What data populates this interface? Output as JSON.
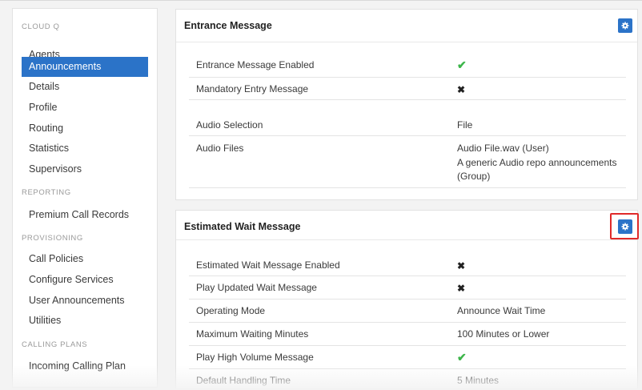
{
  "sidebar": {
    "sections": [
      {
        "heading": "CLOUD Q",
        "items": [
          "Agents",
          "Announcements",
          "Details",
          "Profile",
          "Routing",
          "Statistics",
          "Supervisors"
        ],
        "active": "Announcements"
      },
      {
        "heading": "REPORTING",
        "items": [
          "Premium Call Records"
        ]
      },
      {
        "heading": "PROVISIONING",
        "items": [
          "Call Policies",
          "Configure Services",
          "User Announcements",
          "Utilities"
        ]
      },
      {
        "heading": "CALLING PLANS",
        "items": [
          "Incoming Calling Plan"
        ]
      }
    ]
  },
  "entrance": {
    "title": "Entrance Message",
    "rows": [
      {
        "label": "Entrance Message Enabled",
        "value_icon": "check-icon"
      },
      {
        "label": "Mandatory Entry Message",
        "value_icon": "x-icon"
      },
      {
        "label": "Audio Selection",
        "value": "File"
      },
      {
        "label": "Audio Files",
        "value_lines": [
          "Audio File.wav (User)",
          "A generic Audio repo announcements",
          "(Group)"
        ]
      }
    ]
  },
  "wait": {
    "title": "Estimated Wait Message",
    "rows": [
      {
        "label": "Estimated Wait Message Enabled",
        "value_icon": "x-icon"
      },
      {
        "label": "Play Updated Wait Message",
        "value_icon": "x-icon"
      },
      {
        "label": "Operating Mode",
        "value": "Announce Wait Time"
      },
      {
        "label": "Maximum Waiting Minutes",
        "value": "100 Minutes or Lower"
      },
      {
        "label": "Play High Volume Message",
        "value_icon": "check-icon"
      },
      {
        "label": "Default Handling Time",
        "value": "5 Minutes"
      }
    ]
  },
  "icons": {
    "check": "✔",
    "x": "✖",
    "gear": "⚙"
  },
  "colors": {
    "accent": "#2b73c8",
    "check": "#3cb54a",
    "highlight": "#e02a2a"
  }
}
